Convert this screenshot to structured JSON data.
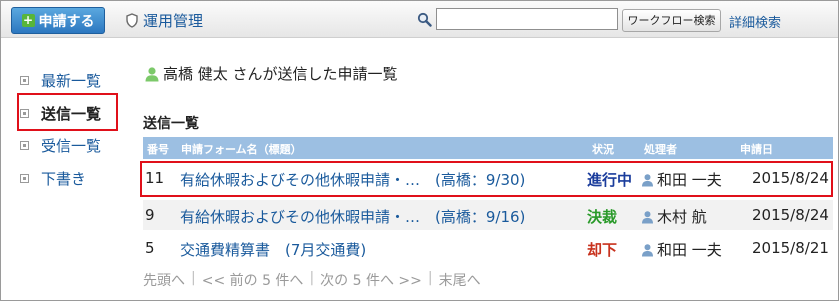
{
  "toolbar": {
    "new_request_label": "申請する",
    "admin_label": "運用管理",
    "search_value": "",
    "workflow_search_label": "ワークフロー検索",
    "advanced_search_label": "詳細検索"
  },
  "sidebar": {
    "items": [
      {
        "label": "最新一覧",
        "active": false
      },
      {
        "label": "送信一覧",
        "active": true
      },
      {
        "label": "受信一覧",
        "active": false
      },
      {
        "label": "下書き",
        "active": false
      }
    ]
  },
  "main": {
    "heading": "高橋 健太 さんが送信した申請一覧",
    "section_title": "送信一覧",
    "columns": [
      "番号",
      "申請フォーム名（標題）",
      "状況",
      "処理者",
      "申請日"
    ],
    "rows": [
      {
        "number": "11",
        "form": "有給休暇およびその他休暇申請・…　(高橋：9/30)",
        "status": "進行中",
        "status_color": "#1a3c9c",
        "handler": "和田 一夫",
        "date": "2015/8/24"
      },
      {
        "number": "9",
        "form": "有給休暇およびその他休暇申請・…　(高橋：9/16)",
        "status": "決裁",
        "status_color": "#2a9a2a",
        "handler": "木村 航",
        "date": "2015/8/24"
      },
      {
        "number": "5",
        "form": "交通費精算書　(7月交通費)",
        "status": "却下",
        "status_color": "#c8321e",
        "handler": "和田 一夫",
        "date": "2015/8/21"
      }
    ],
    "pager": {
      "first": "先頭へ",
      "prev": "<< 前の 5 件へ",
      "next": "次の 5 件へ >>",
      "last": "末尾へ"
    }
  },
  "colors": {
    "accent": "#2c77c0",
    "link": "#1a5a9c",
    "table_header": "#9cbfe2",
    "highlight": "#e0101a"
  },
  "icons": [
    "plus-icon",
    "shield-icon",
    "search-icon",
    "bullet-icon",
    "user-icon"
  ]
}
